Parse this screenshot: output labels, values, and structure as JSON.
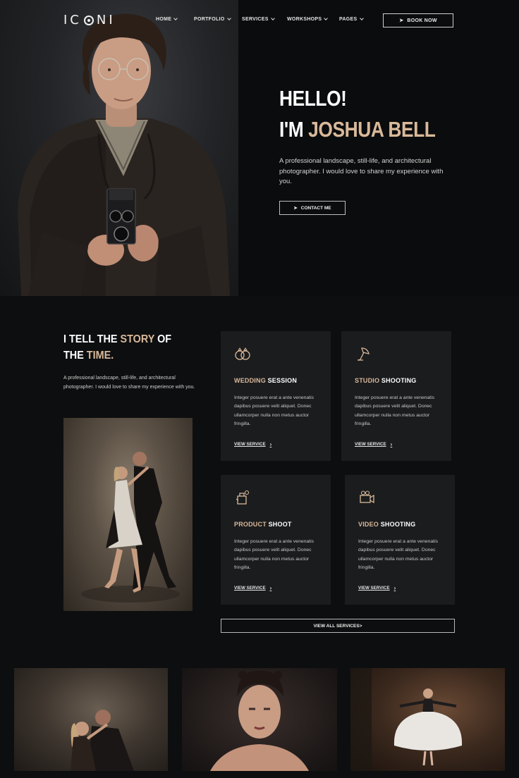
{
  "nav": {
    "logo": "ICONI",
    "menu": [
      {
        "label": "HOME"
      },
      {
        "label": "PORTFOLIO"
      },
      {
        "label": "SERVICES"
      },
      {
        "label": "WORKSHOPS"
      },
      {
        "label": "PAGES"
      }
    ],
    "book_label": "BOOK NOW"
  },
  "hero": {
    "line1": "HELLO!",
    "line2_prefix": "I'M ",
    "line2_name": "JOSHUA BELL",
    "description": "A professional landscape, still-life, and architectural photographer. I would love to share my experience with you.",
    "contact_label": "CONTACT ME"
  },
  "story": {
    "title_a": "I TELL THE ",
    "title_accent1": "STORY",
    "title_b": " OF THE ",
    "title_accent2": "TIME.",
    "description": "A professional landscape, still-life, and architectural photographer. I would love to share my experience with you."
  },
  "services": [
    {
      "title_accent": "WEDDING",
      "title_rest": " SESSION",
      "icon": "rings-icon",
      "description": "Integer posuere erat a ante venenatis dapibus posuere velit aliquet. Donec ullamcorper nulla non metus auctor fringilla.",
      "link": "VIEW SERVICE"
    },
    {
      "title_accent": "STUDIO",
      "title_rest": " SHOOTING",
      "icon": "studio-light-icon",
      "description": "Integer posuere erat a ante venenatis dapibus posuere velit aliquet. Donec ullamcorper nulla non metus auctor fringilla.",
      "link": "VIEW SERVICE"
    },
    {
      "title_accent": "PRODUCT",
      "title_rest": " SHOOT",
      "icon": "product-icon",
      "description": "Integer posuere erat a ante venenatis dapibus posuere velit aliquet. Donec ullamcorper nulla non metus auctor fringilla.",
      "link": "VIEW SERVICE"
    },
    {
      "title_accent": "VIDEO",
      "title_rest": " SHOOTING",
      "icon": "video-camera-icon",
      "description": "Integer posuere erat a ante venenatis dapibus posuere velit aliquet. Donec ullamcorper nulla non metus auctor fringilla.",
      "link": "VIEW SERVICE"
    }
  ],
  "all_services_label": "VIEW ALL SERVICES>",
  "colors": {
    "accent": "#d9b99a",
    "background": "#0d0e0f",
    "card": "#1b1c1e"
  }
}
